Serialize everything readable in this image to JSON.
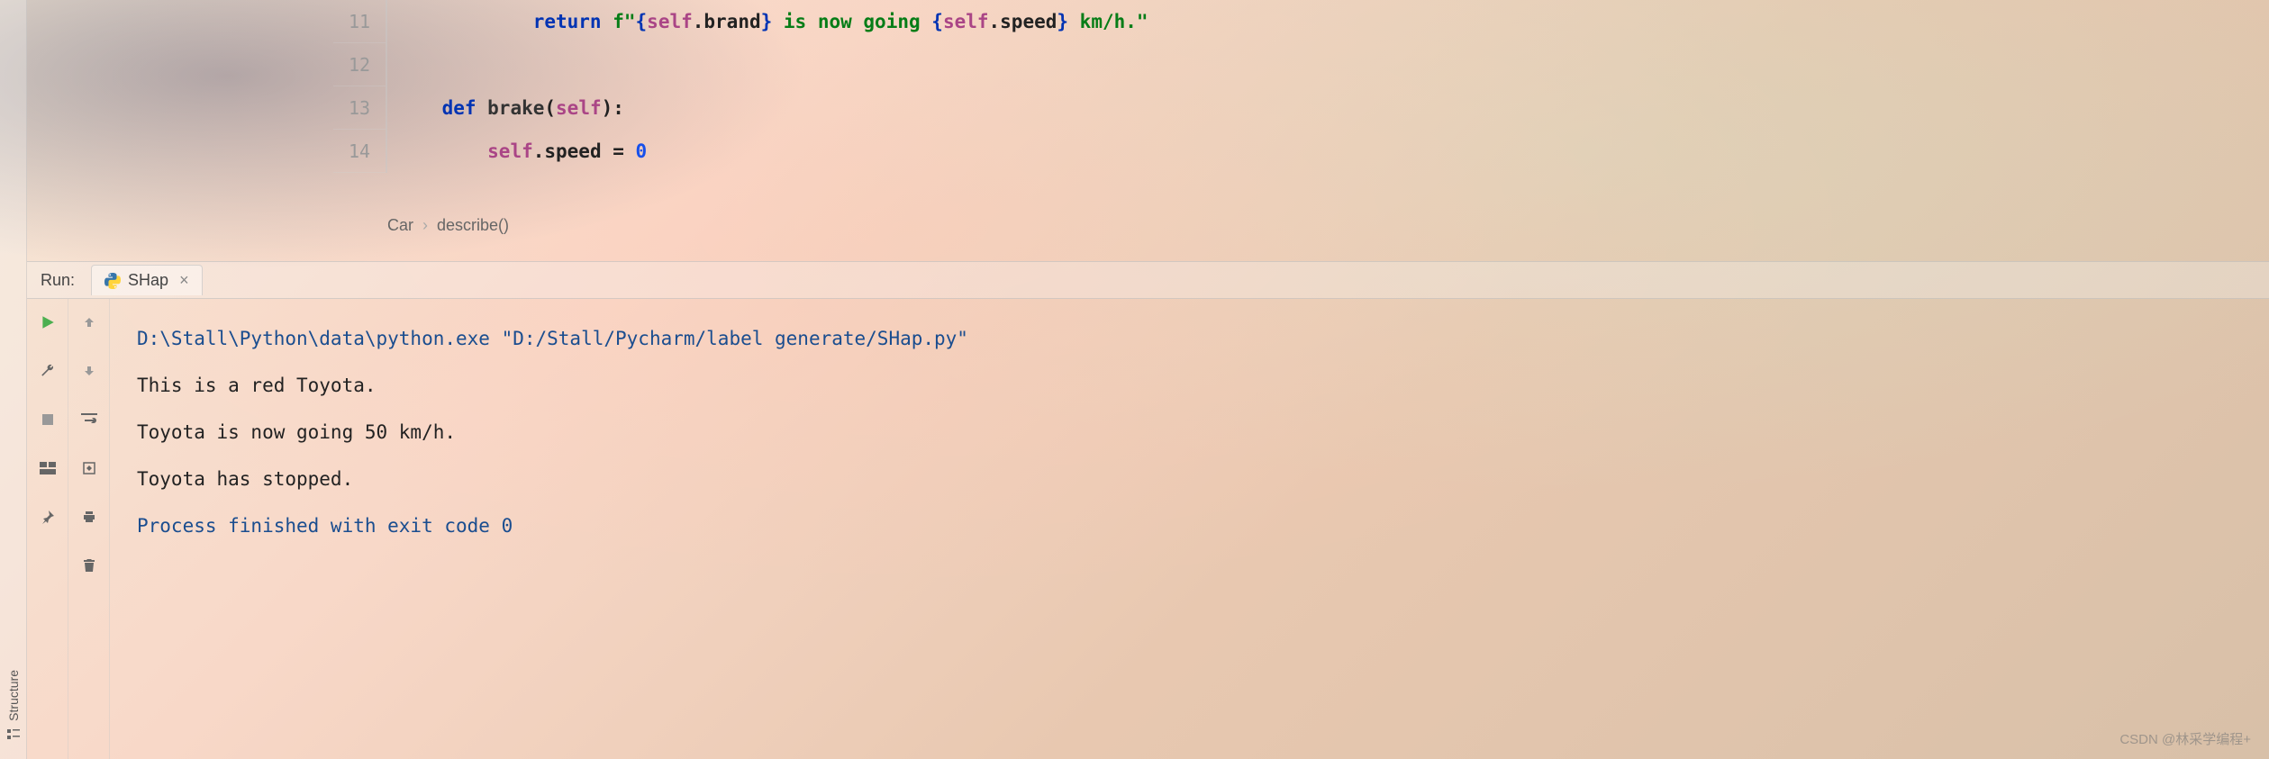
{
  "editor": {
    "lines": [
      {
        "num": "11",
        "segments": [
          {
            "cls": "kw",
            "t": "            return "
          },
          {
            "cls": "str",
            "t": "f\""
          },
          {
            "cls": "kw",
            "t": "{"
          },
          {
            "cls": "self",
            "t": "self"
          },
          {
            "cls": "txt",
            "t": ".brand"
          },
          {
            "cls": "kw",
            "t": "}"
          },
          {
            "cls": "str",
            "t": " is now going "
          },
          {
            "cls": "kw",
            "t": "{"
          },
          {
            "cls": "self",
            "t": "self"
          },
          {
            "cls": "txt",
            "t": ".speed"
          },
          {
            "cls": "kw",
            "t": "}"
          },
          {
            "cls": "str",
            "t": " km/h.\""
          }
        ]
      },
      {
        "num": "12",
        "segments": []
      },
      {
        "num": "13",
        "segments": [
          {
            "cls": "kw",
            "t": "    def "
          },
          {
            "cls": "fn",
            "t": "brake"
          },
          {
            "cls": "txt",
            "t": "("
          },
          {
            "cls": "self",
            "t": "self"
          },
          {
            "cls": "txt",
            "t": "):"
          }
        ]
      },
      {
        "num": "14",
        "segments": [
          {
            "cls": "txt",
            "t": "        "
          },
          {
            "cls": "self",
            "t": "self"
          },
          {
            "cls": "txt",
            "t": ".speed = "
          },
          {
            "cls": "num",
            "t": "0"
          }
        ]
      }
    ]
  },
  "breadcrumb": {
    "cls": "Car",
    "method": "describe()"
  },
  "sidebar": {
    "structure_label": "Structure"
  },
  "run": {
    "label": "Run:",
    "tab_name": "SHap",
    "output": {
      "command": "D:\\Stall\\Python\\data\\python.exe \"D:/Stall/Pycharm/label generate/SHap.py\"",
      "lines": [
        "This is a red Toyota.",
        "Toyota is now going 50 km/h.",
        "Toyota has stopped.",
        "",
        "Process finished with exit code 0"
      ]
    }
  },
  "watermark": "CSDN @林采学编程+"
}
